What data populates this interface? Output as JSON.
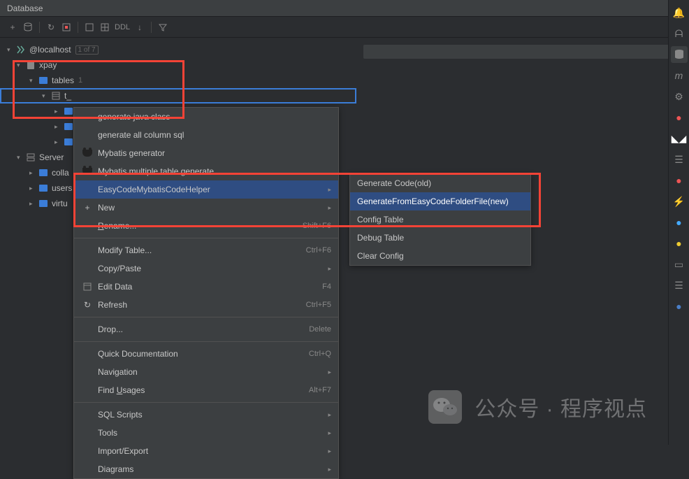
{
  "title": "Database",
  "toolbar": {
    "ddl": "DDL"
  },
  "tree": {
    "root": {
      "label": "@localhost",
      "badge": "1 of 7"
    },
    "xpay": "xpay",
    "tables": {
      "label": "tables",
      "count": "1"
    },
    "selected_table_prefix": "t_",
    "server": "Server",
    "colla": "colla",
    "users": "users",
    "virtu": "virtu"
  },
  "menu": {
    "gen_java": "generate java class",
    "gen_sql": "generate all column sql",
    "mybatis_gen": "Mybatis generator",
    "mybatis_multi": "Mybatis multiple table generate",
    "easycode": "EasyCodeMybatisCodeHelper",
    "new": "New",
    "rename": "Rename...",
    "rename_shortcut": "Shift+F6",
    "modify": "Modify Table...",
    "modify_shortcut": "Ctrl+F6",
    "copy": "Copy/Paste",
    "edit": "Edit Data",
    "edit_shortcut": "F4",
    "refresh": "Refresh",
    "refresh_shortcut": "Ctrl+F5",
    "drop": "Drop...",
    "drop_shortcut": "Delete",
    "quickdoc": "Quick Documentation",
    "quickdoc_shortcut": "Ctrl+Q",
    "nav": "Navigation",
    "usages": "Find Usages",
    "usages_shortcut": "Alt+F7",
    "sql": "SQL Scripts",
    "tools": "Tools",
    "import": "Import/Export",
    "diagrams": "Diagrams"
  },
  "submenu": {
    "gen_old": "Generate Code(old)",
    "gen_new": "GenerateFromEasyCodeFolderFile(new)",
    "config": "Config Table",
    "debug": "Debug Table",
    "clear": "Clear Config"
  },
  "watermark": "公众号 · 程序视点"
}
